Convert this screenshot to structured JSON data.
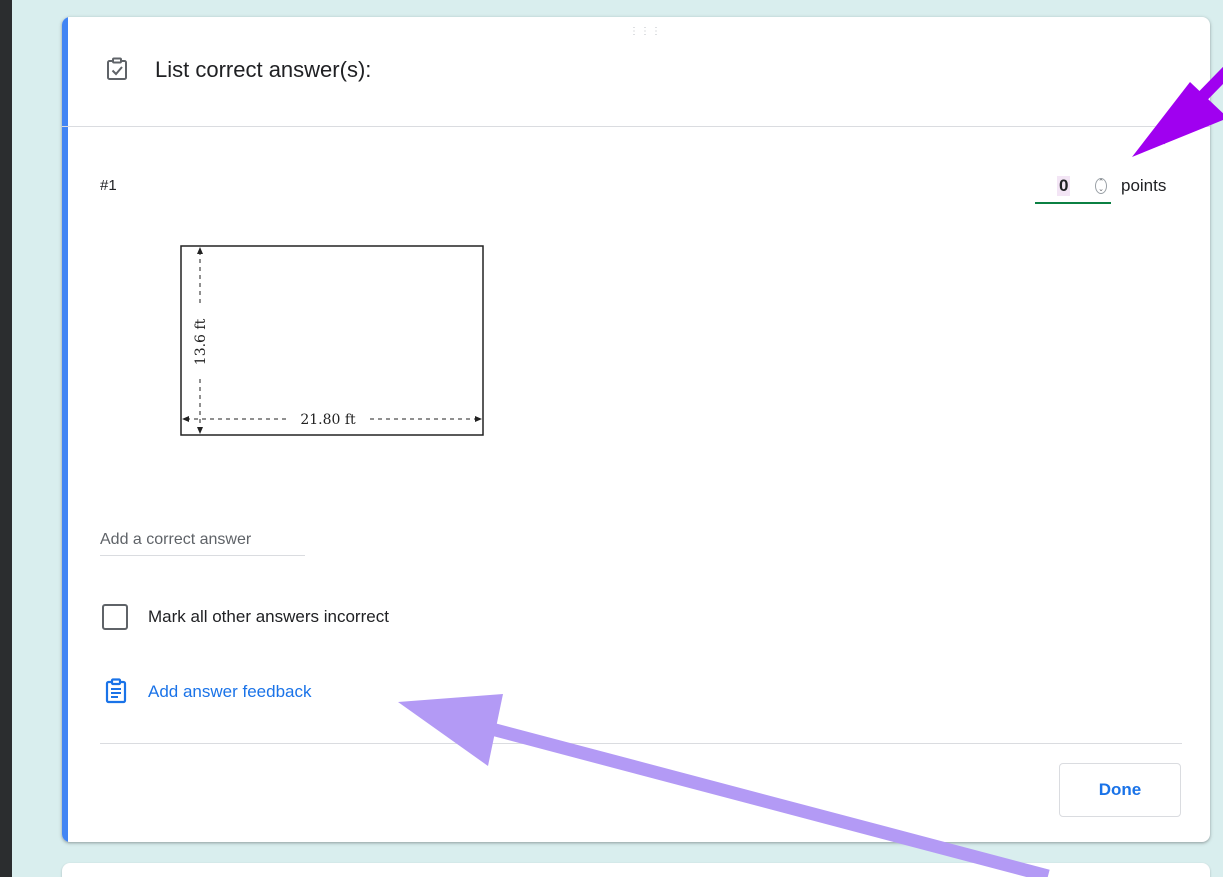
{
  "question": {
    "header_title": "List correct answer(s):",
    "number": "#1",
    "points_value": "0",
    "points_label": "points"
  },
  "figure": {
    "height_label": "13.6 ft",
    "width_label": "21.80 ft"
  },
  "answer": {
    "placeholder": "Add a correct answer"
  },
  "options": {
    "mark_incorrect_label": "Mark all other answers incorrect",
    "mark_incorrect_checked": false,
    "feedback_link": "Add answer feedback"
  },
  "actions": {
    "done_label": "Done"
  },
  "icons": {
    "header": "checkbox-clipboard-icon",
    "feedback": "feedback-clipboard-icon",
    "drag": "drag-handle-icon"
  },
  "colors": {
    "accent": "#4285f4",
    "link": "#1a73e8",
    "points_underline": "#0b8043",
    "arrow_dark": "#a000f0",
    "arrow_light": "#b39af5"
  }
}
